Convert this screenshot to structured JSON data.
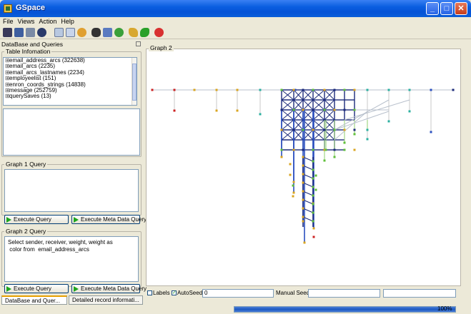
{
  "window": {
    "title": "GSpace"
  },
  "menu": [
    "File",
    "Views",
    "Action",
    "Help"
  ],
  "left_panel": {
    "header": "DataBase and Queries",
    "table_info_label": "Table Infomation",
    "tables": [
      "email_address_arcs (322638)",
      "email_arcs (2235)",
      "email_arcs_lastnames (2234)",
      "employeelist (151)",
      "enron_coords_strings (14838)",
      "message (252759)",
      "querySaves (13)"
    ],
    "graph1_query_label": "Graph 1 Query",
    "graph1_query_text": "",
    "graph2_query_label": "Graph 2 Query",
    "graph2_query_text": "Select sender, receiver, weight, weight as\n color from  email_address_arcs",
    "execute_query": "Execute Query",
    "execute_meta": "Execute Meta Data Query",
    "tabs": [
      "DataBase and Quer...",
      "Detailed record informati..."
    ]
  },
  "graph": {
    "label": "Graph 2",
    "colors": {
      "navy": "#1c2a7a",
      "green": "#5fbf3a",
      "orange": "#d9a520",
      "red": "#cc2222",
      "teal": "#2bb0a0",
      "blue": "#2a4fc0"
    }
  },
  "controls": {
    "labels_text": "Labels",
    "labels_checked": false,
    "autoseed_text": "AutoSeed",
    "autoseed_checked": true,
    "autoseed_value": "0",
    "manual_seed_text": "Manual Seed",
    "manual_seed_value": ""
  },
  "progress": {
    "value": 100,
    "text": "100%"
  }
}
